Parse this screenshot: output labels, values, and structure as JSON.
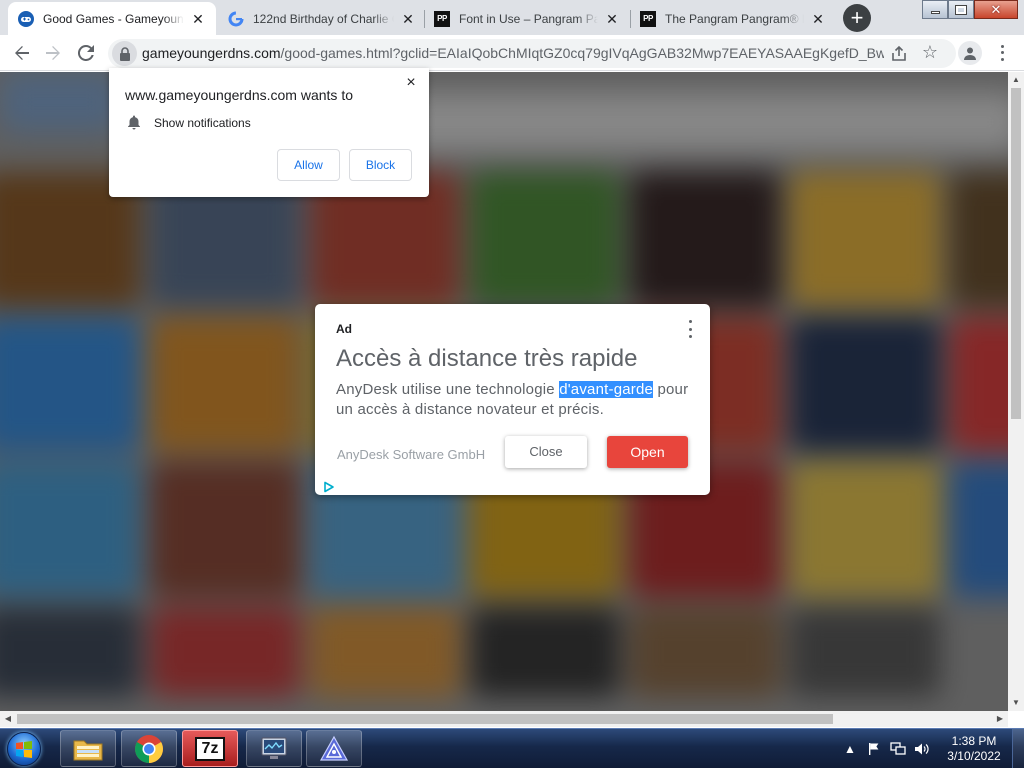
{
  "browser": {
    "tabs": [
      {
        "title": "Good Games - Gameyoung",
        "favicon": "gamepad-icon"
      },
      {
        "title": "122nd Birthday of Charlie C",
        "favicon": "google-g-icon"
      },
      {
        "title": "Font in Use – Pangram Pan",
        "favicon": "pp-logo-icon"
      },
      {
        "title": "The Pangram Pangram® P",
        "favicon": "pp-logo-icon"
      }
    ],
    "favicon_text": "PP",
    "new_tab_label": "+",
    "url_host": "gameyoungerdns.com",
    "url_path": "/good-games.html?gclid=EAIaIQobChMIqtGZ0cq79gIVqAgGAB32Mwp7EAEYASAAEgKgefD_Bw..."
  },
  "permission_popup": {
    "title": "www.gameyoungerdns.com wants to",
    "permission_label": "Show notifications",
    "allow_label": "Allow",
    "block_label": "Block",
    "close_glyph": "×"
  },
  "ad": {
    "tag": "Ad",
    "headline": "Accès à distance très rapide",
    "body_pre": "AnyDesk utilise une technologie ",
    "body_highlight": "d'avant-garde",
    "body_post": " pour un accès à distance novateur et précis.",
    "advertiser": "AnyDesk Software GmbH",
    "close_label": "Close",
    "open_label": "Open",
    "open_color": "#e8453c",
    "highlight_color": "#3390ff"
  },
  "taskbar": {
    "apps": [
      "file-explorer-icon",
      "chrome-icon",
      "7zip-icon",
      "network-monitor-icon",
      "app-triangle-icon"
    ],
    "sevenzip_label": "7z",
    "clock_time": "1:38 PM",
    "clock_date": "3/10/2022"
  }
}
